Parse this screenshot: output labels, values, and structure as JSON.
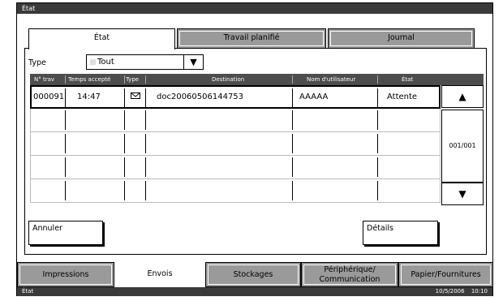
{
  "window": {
    "title": "État"
  },
  "top_tabs": [
    {
      "label": "État",
      "active": true
    },
    {
      "label": "Travail planifié",
      "active": false
    },
    {
      "label": "Journal",
      "active": false
    }
  ],
  "filter": {
    "label": "Type",
    "selected": "Tout"
  },
  "table": {
    "columns": [
      "N° trav",
      "Temps accepté",
      "Type",
      "Destination",
      "Nom d'utilisateur",
      "État"
    ],
    "rows": [
      {
        "job_no": "000091",
        "time": "14:47",
        "type_icon": "envelope-icon",
        "destination": "doc20060506144753",
        "user": "AAAAA",
        "status": "Attente"
      }
    ],
    "page": "001/001"
  },
  "buttons": {
    "cancel": "Annuler",
    "details": "Détails"
  },
  "bottom_tabs": [
    {
      "label": "Impressions",
      "active": false
    },
    {
      "label": "Envois",
      "active": true
    },
    {
      "label": "Stockages",
      "active": false
    },
    {
      "label": "Périphérique/ Communication",
      "active": false
    },
    {
      "label": "Papier/Fournitures",
      "active": false
    }
  ],
  "status_bar": {
    "left": "État",
    "date": "10/5/2006",
    "time": "10:10"
  }
}
